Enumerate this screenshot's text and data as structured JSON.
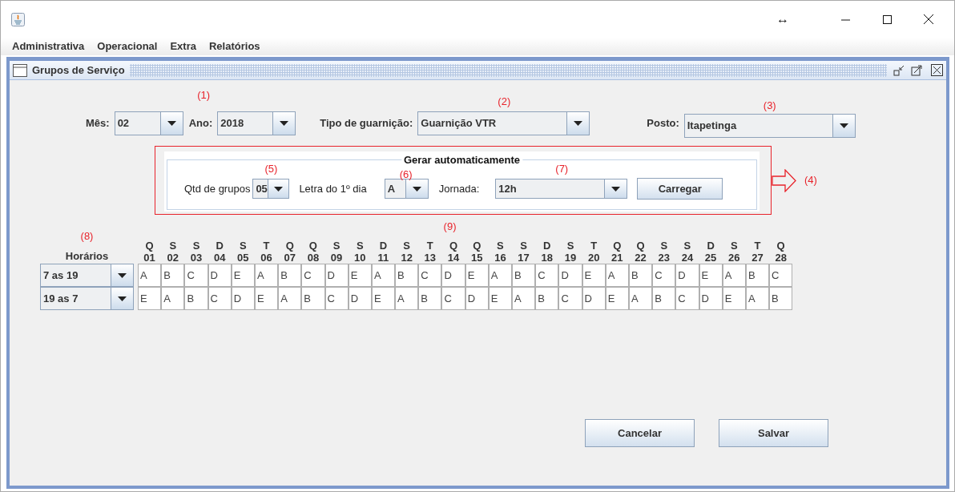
{
  "window": {
    "title_glyph": "↔"
  },
  "menu": [
    "Administrativa",
    "Operacional",
    "Extra",
    "Relatórios"
  ],
  "frame": {
    "title": "Grupos de Serviço"
  },
  "filters": [
    {
      "label": "Mês:",
      "value": "02"
    },
    {
      "label": "Ano:",
      "value": "2018",
      "annotation": "(1)"
    },
    {
      "label": "Tipo de guarnição:",
      "value": "Guarnição VTR",
      "annotation": "(2)"
    },
    {
      "label": "Posto:",
      "value": "Itapetinga",
      "annotation": "(3)"
    }
  ],
  "auto_generate": {
    "title": "Gerar automaticamente",
    "annotation": "(4)",
    "fields": [
      {
        "label": "Qtd de grupos",
        "value": "05",
        "annotation": "(5)"
      },
      {
        "label": "Letra do 1º dia",
        "value": "A",
        "annotation": "(6)"
      },
      {
        "label": "Jornada:",
        "value": "12h",
        "annotation": "(7)"
      }
    ],
    "button": "Carregar"
  },
  "schedule": {
    "header_label": "Horários",
    "header_annotation": "(8)",
    "days_annotation": "(9)",
    "days": [
      {
        "weekday": "Q",
        "number": "01"
      },
      {
        "weekday": "S",
        "number": "02"
      },
      {
        "weekday": "S",
        "number": "03"
      },
      {
        "weekday": "D",
        "number": "04"
      },
      {
        "weekday": "S",
        "number": "05"
      },
      {
        "weekday": "T",
        "number": "06"
      },
      {
        "weekday": "Q",
        "number": "07"
      },
      {
        "weekday": "Q",
        "number": "08"
      },
      {
        "weekday": "S",
        "number": "09"
      },
      {
        "weekday": "S",
        "number": "10"
      },
      {
        "weekday": "D",
        "number": "11"
      },
      {
        "weekday": "S",
        "number": "12"
      },
      {
        "weekday": "T",
        "number": "13"
      },
      {
        "weekday": "Q",
        "number": "14"
      },
      {
        "weekday": "Q",
        "number": "15"
      },
      {
        "weekday": "S",
        "number": "16"
      },
      {
        "weekday": "S",
        "number": "17"
      },
      {
        "weekday": "D",
        "number": "18"
      },
      {
        "weekday": "S",
        "number": "19"
      },
      {
        "weekday": "T",
        "number": "20"
      },
      {
        "weekday": "Q",
        "number": "21"
      },
      {
        "weekday": "Q",
        "number": "22"
      },
      {
        "weekday": "S",
        "number": "23"
      },
      {
        "weekday": "S",
        "number": "24"
      },
      {
        "weekday": "D",
        "number": "25"
      },
      {
        "weekday": "S",
        "number": "26"
      },
      {
        "weekday": "T",
        "number": "27"
      },
      {
        "weekday": "Q",
        "number": "28"
      }
    ],
    "rows": [
      {
        "shift": "7 as 19",
        "cells": [
          "A",
          "B",
          "C",
          "D",
          "E",
          "A",
          "B",
          "C",
          "D",
          "E",
          "A",
          "B",
          "C",
          "D",
          "E",
          "A",
          "B",
          "C",
          "D",
          "E",
          "A",
          "B",
          "C",
          "D",
          "E",
          "A",
          "B",
          "C"
        ]
      },
      {
        "shift": "19 as 7",
        "cells": [
          "E",
          "A",
          "B",
          "C",
          "D",
          "E",
          "A",
          "B",
          "C",
          "D",
          "E",
          "A",
          "B",
          "C",
          "D",
          "E",
          "A",
          "B",
          "C",
          "D",
          "E",
          "A",
          "B",
          "C",
          "D",
          "E",
          "A",
          "B"
        ]
      }
    ]
  },
  "buttons": [
    "Cancelar",
    "Salvar"
  ]
}
